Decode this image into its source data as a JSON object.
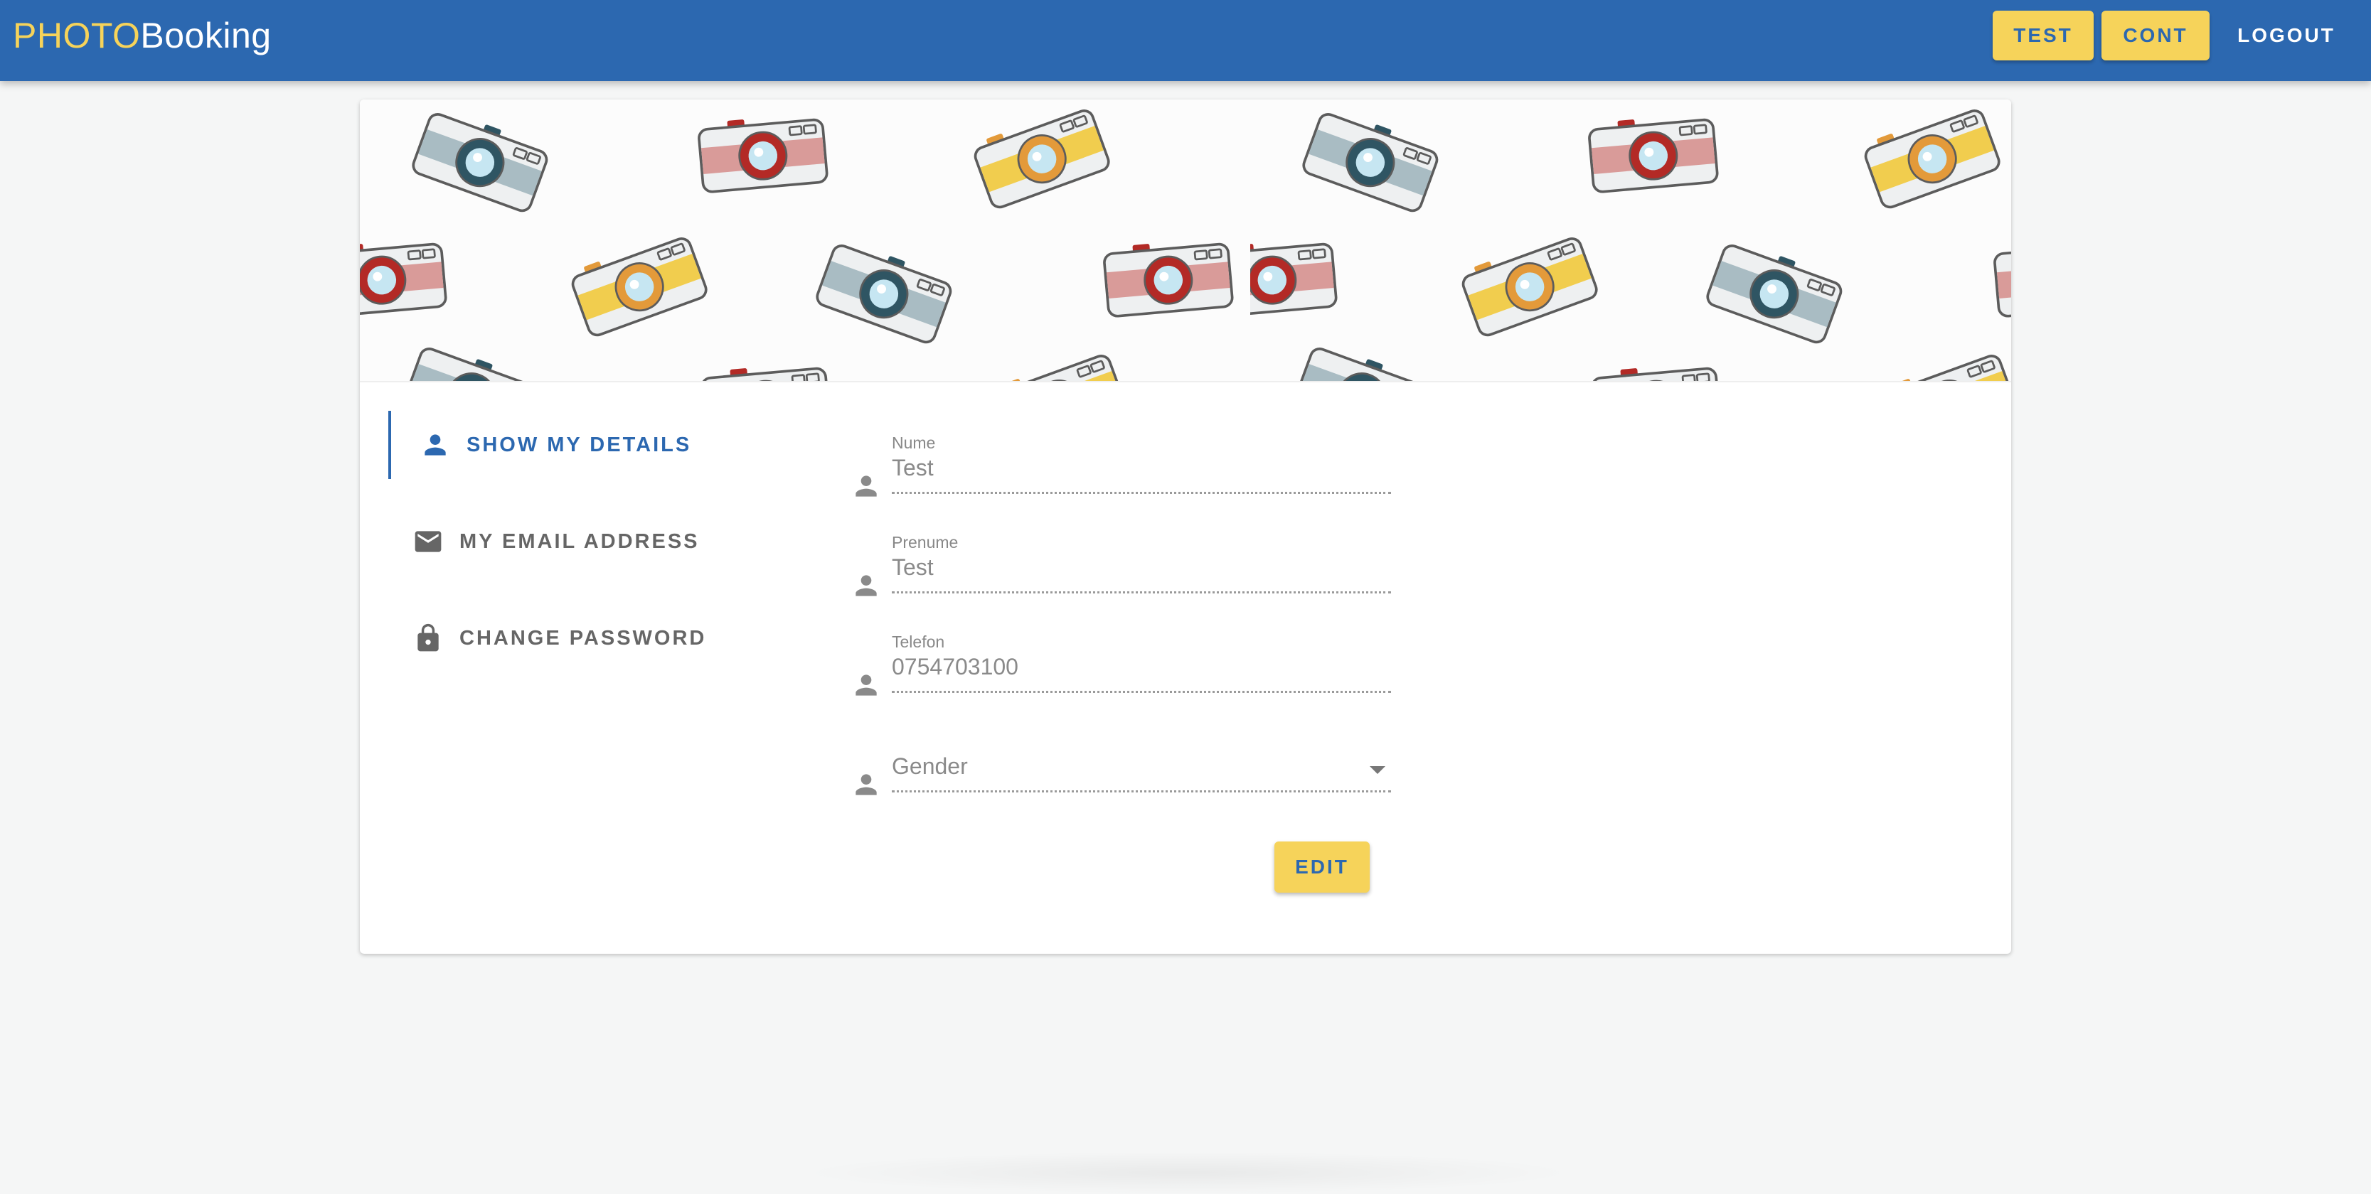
{
  "header": {
    "logo_part1": "PHOTO",
    "logo_part2": "Booking",
    "nav": {
      "test": "TEST",
      "cont": "CONT",
      "logout": "LOGOUT"
    }
  },
  "tabs": [
    {
      "label": "SHOW MY DETAILS",
      "icon": "person-icon",
      "active": true
    },
    {
      "label": "MY EMAIL ADDRESS",
      "icon": "mail-icon",
      "active": false
    },
    {
      "label": "CHANGE PASSWORD",
      "icon": "lock-icon",
      "active": false
    }
  ],
  "form": {
    "nume": {
      "label": "Nume",
      "value": "Test",
      "icon": "person-icon"
    },
    "prenume": {
      "label": "Prenume",
      "value": "Test",
      "icon": "person-icon"
    },
    "telefon": {
      "label": "Telefon",
      "value": "0754703100",
      "icon": "person-icon"
    },
    "gender": {
      "placeholder": "Gender",
      "icon": "person-icon"
    },
    "edit_label": "EDIT"
  },
  "colors": {
    "primary": "#2c68b0",
    "accent": "#f6d35a",
    "background": "#f5f6f6"
  }
}
